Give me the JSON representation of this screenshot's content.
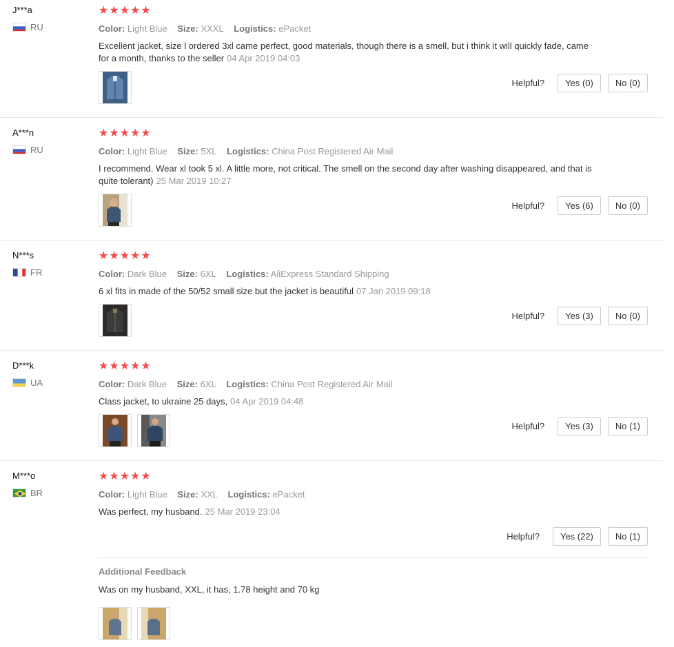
{
  "labels": {
    "color": "Color:",
    "size": "Size:",
    "logistics": "Logistics:",
    "helpful": "Helpful?",
    "stars": "★★★★★"
  },
  "reviews": [
    {
      "user": "J***a",
      "country": "RU",
      "flag_colors": [
        "#ffffff",
        "#3a5fcd",
        "#d52b1e"
      ],
      "color": "Light Blue",
      "size": "XXXL",
      "logistics": "ePacket",
      "text": "Excellent jacket, size l ordered 3xl came perfect, good materials, though there is a smell, but i think it will quickly fade, came for a month, thanks to the seller",
      "date": "04 Apr 2019 04:03",
      "yes": "Yes (0)",
      "no": "No (0)"
    },
    {
      "user": "A***n",
      "country": "RU",
      "flag_colors": [
        "#ffffff",
        "#3a5fcd",
        "#d52b1e"
      ],
      "color": "Light Blue",
      "size": "5XL",
      "logistics": "China Post Registered Air Mail",
      "text": "I recommend. Wear xl took 5 xl. A little more, not critical. The smell on the second day after washing disappeared, and that is quite tolerant)",
      "date": "25 Mar 2019 10:27",
      "yes": "Yes (6)",
      "no": "No (0)"
    },
    {
      "user": "N***s",
      "country": "FR",
      "flag_colors": [
        "#2b4aa0",
        "#ffffff",
        "#e0303a"
      ],
      "color": "Dark Blue",
      "size": "6XL",
      "logistics": "AliExpress Standard Shipping",
      "text": "6 xl fits in made of the 50/52 small size but the jacket is beautiful",
      "date": "07 Jan 2019 09:18",
      "yes": "Yes (3)",
      "no": "No (0)"
    },
    {
      "user": "D***k",
      "country": "UA",
      "flag_colors": [
        "#5b9bd5",
        "#f5d547"
      ],
      "color": "Dark Blue",
      "size": "6XL",
      "logistics": "China Post Registered Air Mail",
      "text": "Class jacket, to ukraine 25 days,",
      "date": "04 Apr 2019 04:48",
      "yes": "Yes (3)",
      "no": "No (1)"
    },
    {
      "user": "M***o",
      "country": "BR",
      "flag_colors": [
        "#2e9b3a",
        "#f6d03c",
        "#2b4aa0"
      ],
      "color": "Light Blue",
      "size": "XXL",
      "logistics": "ePacket",
      "text": "Was perfect, my husband.",
      "date": "25 Mar 2019 23:04",
      "yes": "Yes (22)",
      "no": "No (1)",
      "additional": {
        "title": "Additional Feedback",
        "text": "Was on my husband, XXL, it has, 1.78 height and 70 kg"
      }
    }
  ]
}
